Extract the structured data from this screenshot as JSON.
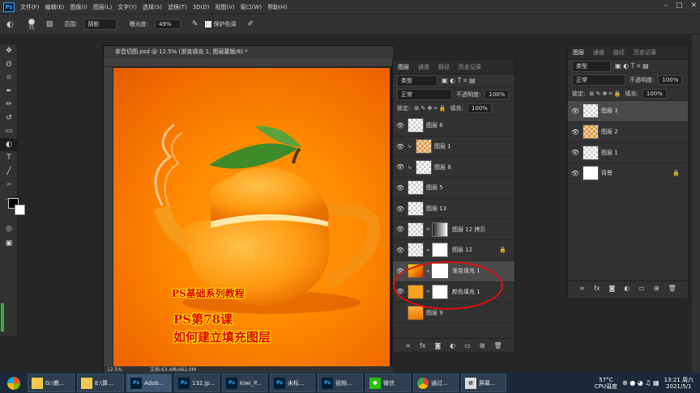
{
  "app": {
    "logo": "Ps"
  },
  "menu": [
    "文件(F)",
    "编辑(E)",
    "图像(I)",
    "图层(L)",
    "文字(Y)",
    "选择(S)",
    "滤镜(T)",
    "3D(D)",
    "视图(V)",
    "窗口(W)",
    "帮助(H)"
  ],
  "options": {
    "brush_size": "35",
    "range_label": "范围:",
    "range_value": "阴影",
    "exposure_label": "曝光度:",
    "exposure_value": "49%",
    "protect_label": "保护色调"
  },
  "document": {
    "tab_title": "茶壶切图.psd @ 12.5% (渐变填充 1, 图层蒙版/8) *",
    "zoom": "12.5%",
    "doc_info": "文档:63.4M/462.0M",
    "overlay_line1": "PS基础系列教程",
    "overlay_line2": "PS第78课",
    "overlay_line3": "如何建立填充图层"
  },
  "layers_panel": {
    "tabs": [
      "图层",
      "通道",
      "路径",
      "历史记录"
    ],
    "filter": "类型",
    "blend_mode": "正常",
    "opacity_label": "不透明度:",
    "opacity_value": "100%",
    "lock_label": "锁定:",
    "fill_label": "填充:",
    "fill_value": "100%",
    "layers": [
      {
        "name": "图层 6"
      },
      {
        "name": "图层 1"
      },
      {
        "name": "图层 8"
      },
      {
        "name": "图层 5"
      },
      {
        "name": "图层 13"
      },
      {
        "name": "图层 12 拷贝"
      },
      {
        "name": "图层 12"
      },
      {
        "name": "渐变填充 1"
      },
      {
        "name": "颜色填充 1"
      },
      {
        "name": "图层 9"
      }
    ]
  },
  "layers_panel_2": {
    "tabs": [
      "图层",
      "通道",
      "路径",
      "历史记录"
    ],
    "filter": "类型",
    "blend_mode": "正常",
    "opacity_label": "不透明度:",
    "opacity_value": "100%",
    "lock_label": "锁定:",
    "fill_label": "填充:",
    "fill_value": "100%",
    "layers": [
      {
        "name": "图层 3"
      },
      {
        "name": "图层 2"
      },
      {
        "name": "图层 1"
      },
      {
        "name": "背景"
      }
    ]
  },
  "taskbar": {
    "items": [
      "G:\\教...",
      "E:\\算...",
      "Adob...",
      "132.jp...",
      "kiwi_P...",
      "未标...",
      "视频...",
      "微信",
      "通过...",
      "屏幕..."
    ],
    "temperature": "57°C",
    "cpu_label": "CPU温度",
    "time": "13:21 周六",
    "date": "2021/5/1"
  },
  "colors": {
    "accent_blue": "#31a8ff",
    "panel_bg": "#323232",
    "highlight_red": "#e00000"
  }
}
